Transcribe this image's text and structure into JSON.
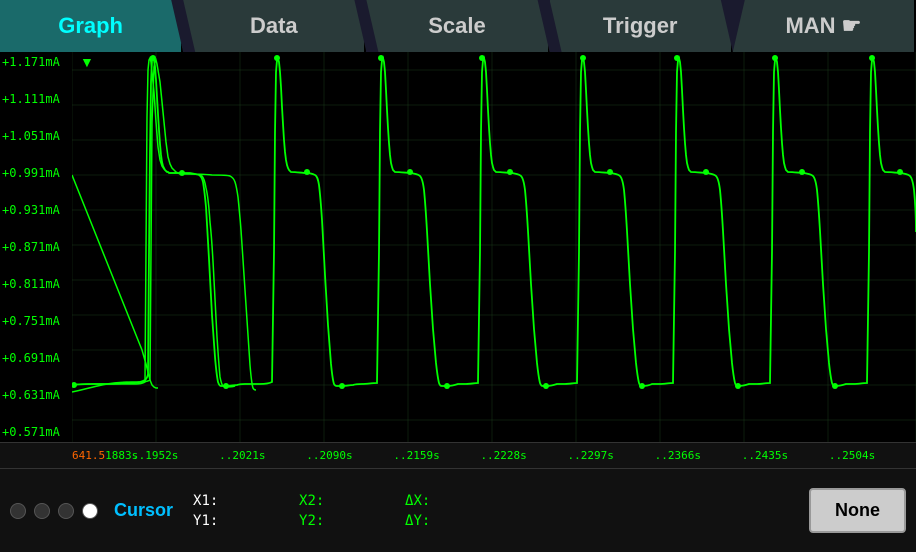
{
  "tabs": [
    {
      "label": "Graph",
      "active": true
    },
    {
      "label": "Data",
      "active": false
    },
    {
      "label": "Scale",
      "active": false
    },
    {
      "label": "Trigger",
      "active": false
    },
    {
      "label": "MAN ☛",
      "active": false
    }
  ],
  "yAxis": {
    "labels": [
      "+1.171mA",
      "+1.111mA",
      "+1.051mA",
      "+0.991mA",
      "+0.931mA",
      "+0.871mA",
      "+0.811mA",
      "+0.751mA",
      "+0.691mA",
      "+0.631mA",
      "+0.571mA"
    ]
  },
  "xAxis": {
    "first_label": "641.5",
    "labels": [
      "1883s",
      "..1952s",
      "..2021s",
      "..2090s",
      "..2159s",
      "..2228s",
      "..2297s",
      "..2366s",
      "..2435s",
      "..2504s"
    ]
  },
  "statusBar": {
    "cursor_label": "Cursor",
    "x1_label": "X1:",
    "y1_label": "Y1:",
    "x2_label": "X2:",
    "y2_label": "Y2:",
    "dx_label": "ΔX:",
    "dy_label": "ΔY:",
    "x1_val": "",
    "y1_val": "",
    "x2_val": "",
    "y2_val": "",
    "dx_val": "",
    "dy_val": "",
    "none_button": "None"
  },
  "colors": {
    "signal": "#00ff00",
    "accent": "#00bfff",
    "tab_active_bg": "#1a6a6a",
    "tab_active_text": "#00ffff",
    "background": "#000000"
  }
}
